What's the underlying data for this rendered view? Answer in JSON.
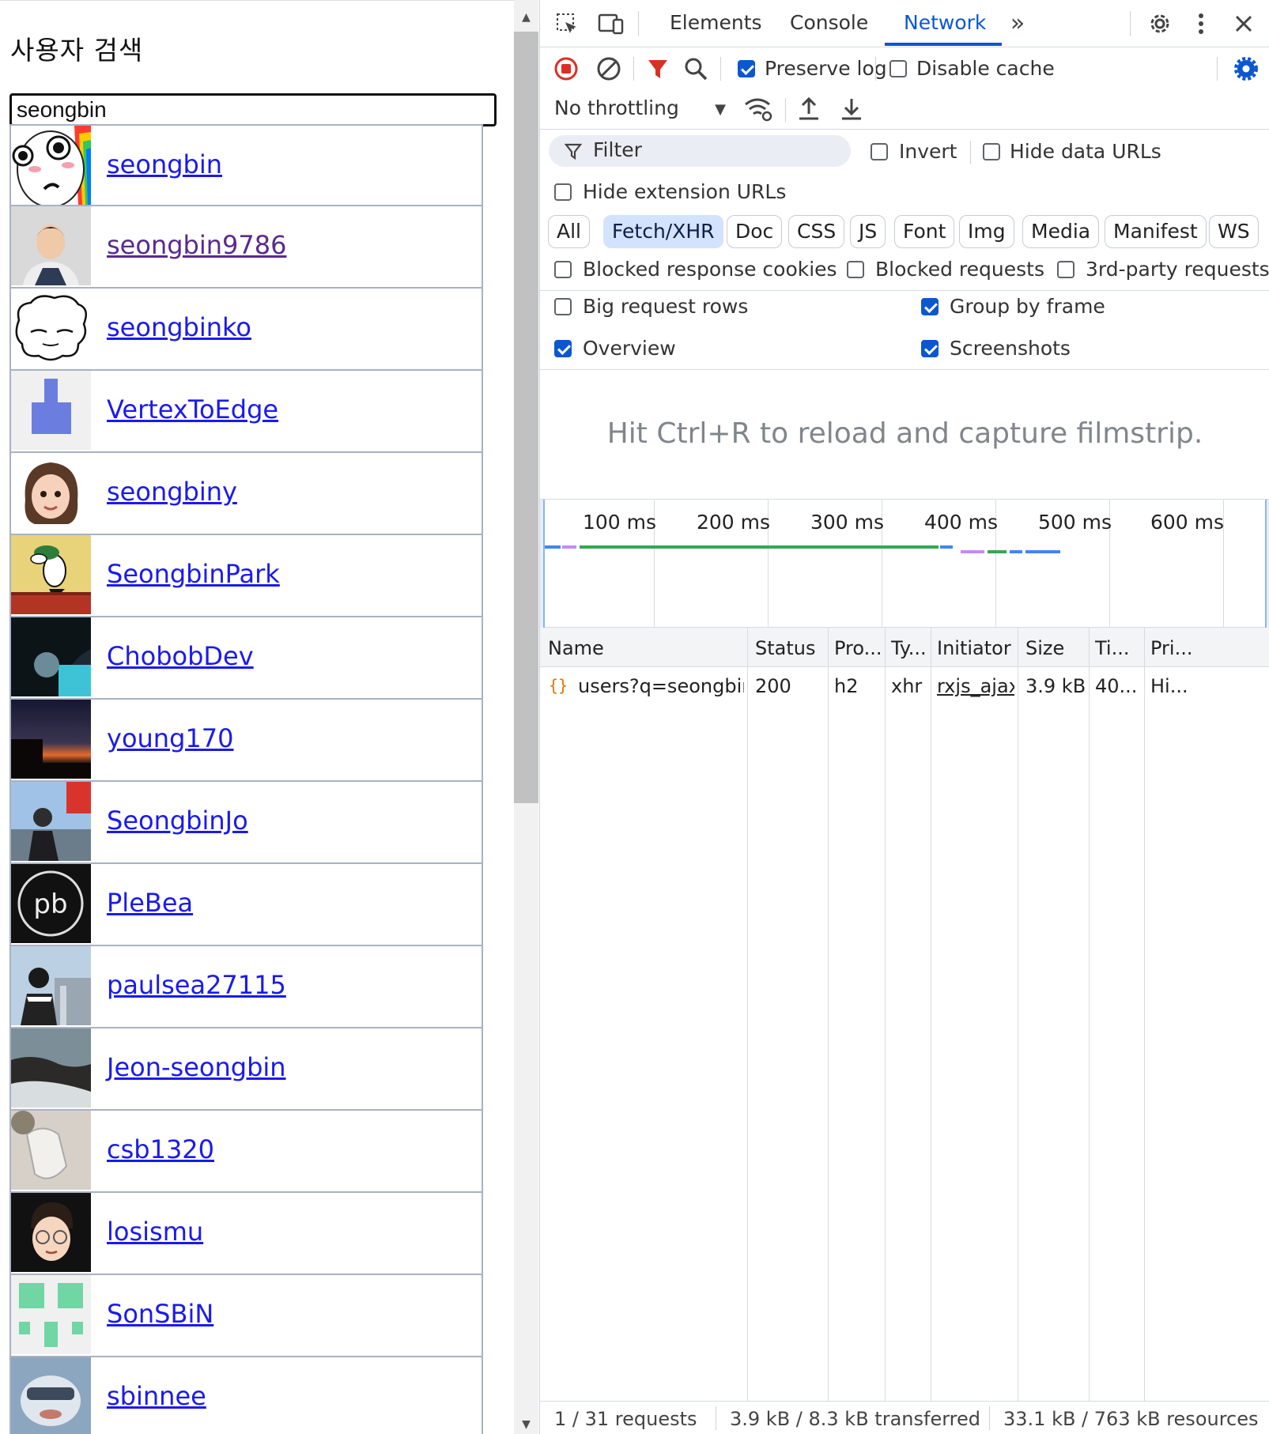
{
  "page": {
    "title": "사용자 검색",
    "search_value": "seongbin",
    "users": [
      {
        "login": "seongbin",
        "visited": false
      },
      {
        "login": "seongbin9786",
        "visited": true
      },
      {
        "login": "seongbinko",
        "visited": false
      },
      {
        "login": "VertexToEdge",
        "visited": false
      },
      {
        "login": "seongbiny",
        "visited": false
      },
      {
        "login": "SeongbinPark",
        "visited": false
      },
      {
        "login": "ChobobDev",
        "visited": false
      },
      {
        "login": "young170",
        "visited": false
      },
      {
        "login": "SeongbinJo",
        "visited": false
      },
      {
        "login": "PleBea",
        "visited": false
      },
      {
        "login": "paulsea27115",
        "visited": false
      },
      {
        "login": "Jeon-seongbin",
        "visited": false
      },
      {
        "login": "csb1320",
        "visited": false
      },
      {
        "login": "losismu",
        "visited": false
      },
      {
        "login": "SonSBiN",
        "visited": false
      },
      {
        "login": "sbinnee",
        "visited": false
      }
    ]
  },
  "devtools": {
    "tabs": [
      "Elements",
      "Console",
      "Network"
    ],
    "active_tab": "Network",
    "more_tabs_icon": "chevron-double-right-icon",
    "preserve_log": {
      "label": "Preserve log",
      "checked": true
    },
    "disable_cache": {
      "label": "Disable cache",
      "checked": false
    },
    "throttling": "No throttling",
    "filter": {
      "placeholder": "Filter"
    },
    "invert": {
      "label": "Invert",
      "checked": false
    },
    "hide_data_urls": {
      "label": "Hide data URLs",
      "checked": false
    },
    "hide_extension_urls": {
      "label": "Hide extension URLs",
      "checked": false
    },
    "resource_types": [
      "All",
      "Fetch/XHR",
      "Doc",
      "CSS",
      "JS",
      "Font",
      "Img",
      "Media",
      "Manifest",
      "WS"
    ],
    "active_type": "Fetch/XHR",
    "blocked_response_cookies": {
      "label": "Blocked response cookies",
      "checked": false
    },
    "blocked_requests": {
      "label": "Blocked requests",
      "checked": false
    },
    "third_party_requests": {
      "label": "3rd-party requests",
      "checked": false
    },
    "big_request_rows": {
      "label": "Big request rows",
      "checked": false
    },
    "group_by_frame": {
      "label": "Group by frame",
      "checked": true
    },
    "overview": {
      "label": "Overview",
      "checked": true
    },
    "screenshots": {
      "label": "Screenshots",
      "checked": true
    },
    "filmstrip_message": "Hit Ctrl+R to reload and capture filmstrip.",
    "timeline_ticks": [
      "100 ms",
      "200 ms",
      "300 ms",
      "400 ms",
      "500 ms",
      "600 ms"
    ],
    "columns": [
      "Name",
      "Status",
      "Pro...",
      "Ty...",
      "Initiator",
      "Size",
      "Ti...",
      "Pri..."
    ],
    "requests": [
      {
        "name": "users?q=seongbin",
        "status": "200",
        "protocol": "h2",
        "type": "xhr",
        "initiator": "rxjs_ajax.js",
        "size": "3.9 kB",
        "time": "40...",
        "priority": "Hi..."
      }
    ],
    "status": {
      "requests": "1 / 31 requests",
      "transferred": "3.9 kB / 8.3 kB transferred",
      "resources": "33.1 kB / 763 kB resources"
    },
    "colors": {
      "accent": "#0b57d0",
      "record": "#d93025",
      "filter_red": "#d93025",
      "timeline_green": "#34a853",
      "timeline_blue": "#4285f4",
      "timeline_purple": "#c58af9"
    }
  }
}
